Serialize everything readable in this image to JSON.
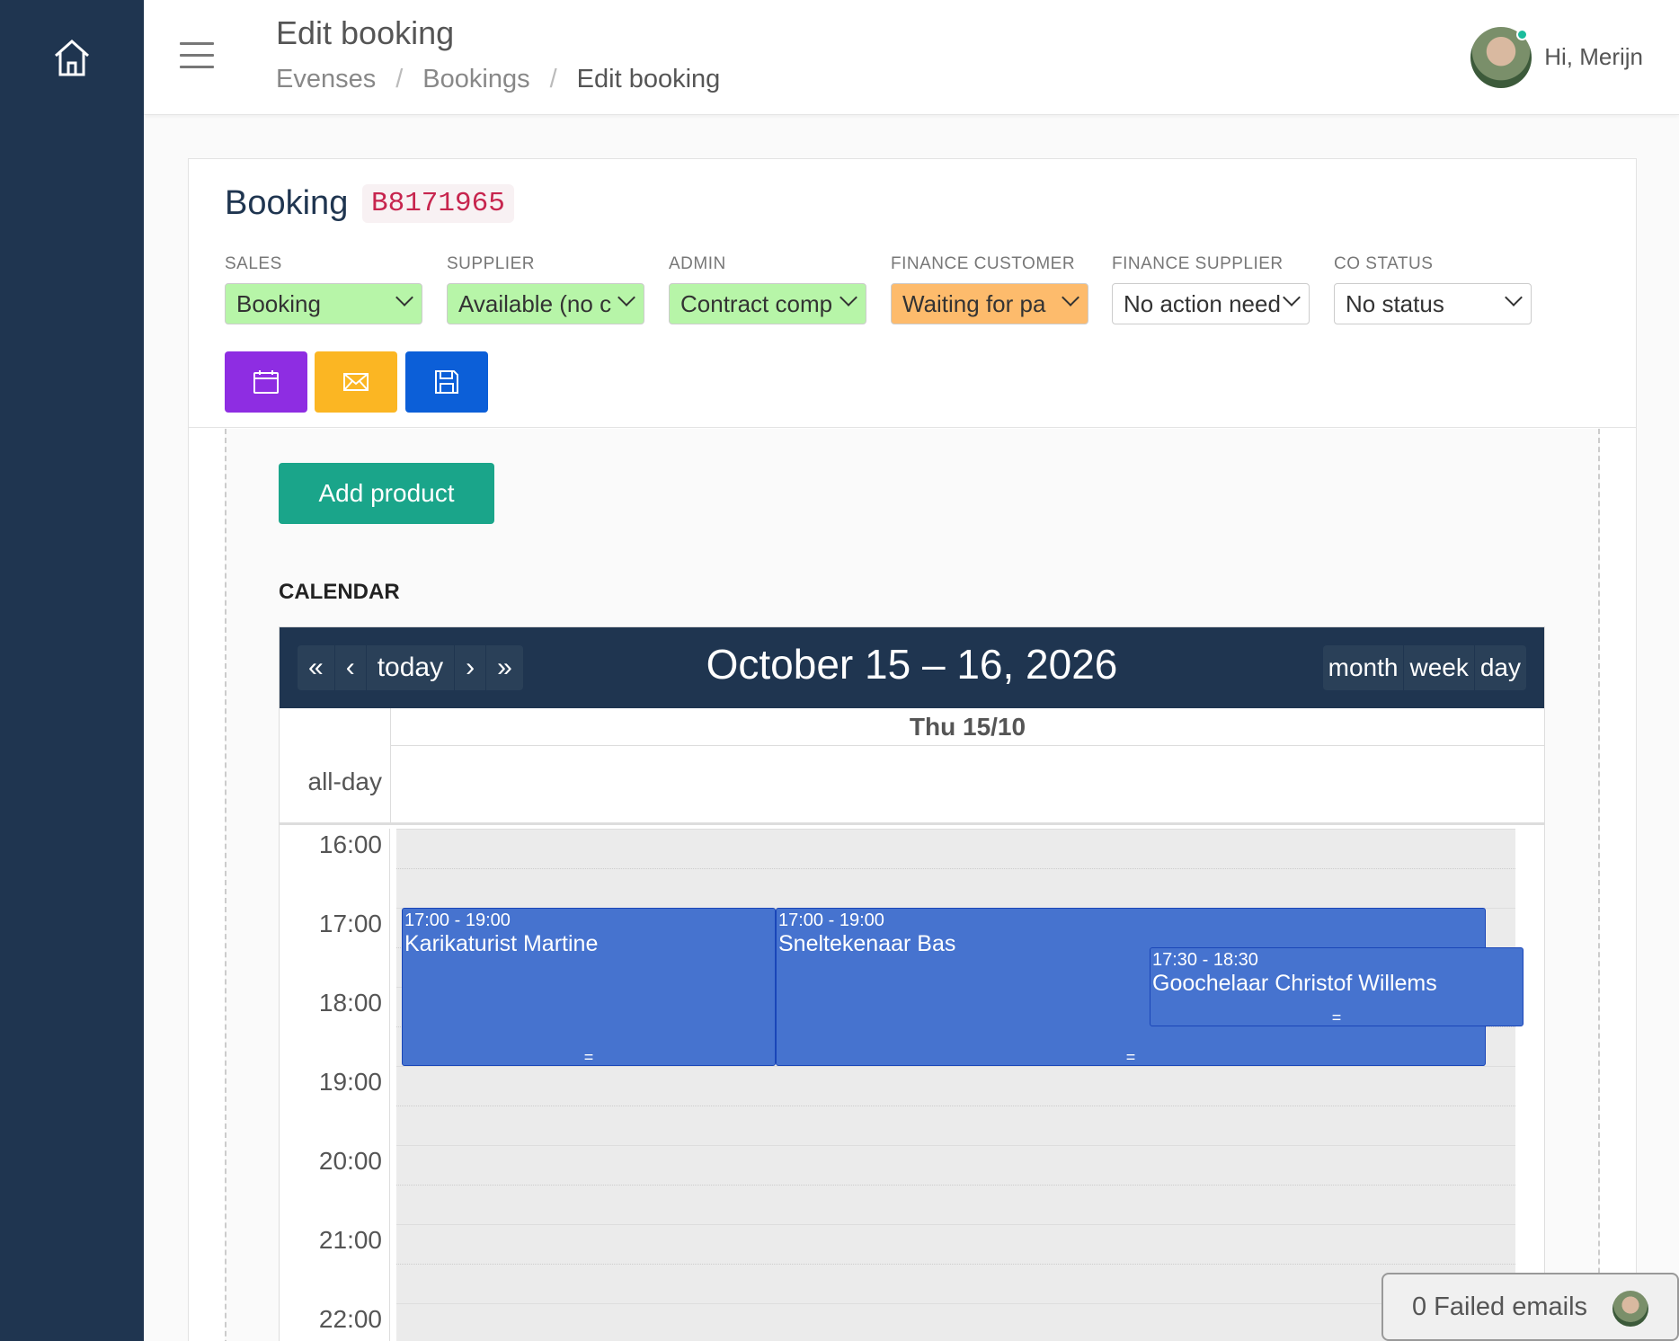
{
  "header": {
    "title": "Edit booking",
    "breadcrumbs": [
      "Evenses",
      "Bookings",
      "Edit booking"
    ],
    "greeting": "Hi, Merijn"
  },
  "booking": {
    "title": "Booking",
    "code": "B8171965",
    "statuses": [
      {
        "label": "SALES",
        "value": "Booking",
        "color": "#b7f5a8"
      },
      {
        "label": "SUPPLIER",
        "value": "Available (no c",
        "color": "#b7f5a8"
      },
      {
        "label": "ADMIN",
        "value": "Contract comp",
        "color": "#b7f5a8"
      },
      {
        "label": "FINANCE CUSTOMER",
        "value": "Waiting for pa",
        "color": "#fdbb6c"
      },
      {
        "label": "FINANCE SUPPLIER",
        "value": "No action need",
        "color": "#ffffff"
      },
      {
        "label": "CO STATUS",
        "value": "No status",
        "color": "#ffffff"
      }
    ],
    "actions": [
      {
        "icon": "calendar-icon",
        "color": "#8e2de2"
      },
      {
        "icon": "envelope-icon",
        "color": "#fbb623"
      },
      {
        "icon": "save-icon",
        "color": "#0c5fd8"
      }
    ]
  },
  "products": {
    "add_label": "Add product"
  },
  "calendar": {
    "section_label": "CALENDAR",
    "nav": {
      "prev_year": "«",
      "prev": "‹",
      "today": "today",
      "next": "›",
      "next_year": "»"
    },
    "title": "October 15 – 16, 2026",
    "views": [
      "month",
      "week",
      "day"
    ],
    "day_header": "Thu 15/10",
    "all_day_label": "all-day",
    "times": [
      "16:00",
      "17:00",
      "18:00",
      "19:00",
      "20:00",
      "21:00",
      "22:00"
    ],
    "events": [
      {
        "time": "17:00 - 19:00",
        "title": "Karikaturist Martine",
        "start": "17:00",
        "end": "19:00"
      },
      {
        "time": "17:00 - 19:00",
        "title": "Sneltekenaar Bas",
        "start": "17:00",
        "end": "19:00"
      },
      {
        "time": "17:30 - 18:30",
        "title": "Goochelaar Christof Willems",
        "start": "17:30",
        "end": "18:30"
      }
    ],
    "event_color": "#4673cf"
  },
  "footer": {
    "failed_emails": "0 Failed emails"
  }
}
